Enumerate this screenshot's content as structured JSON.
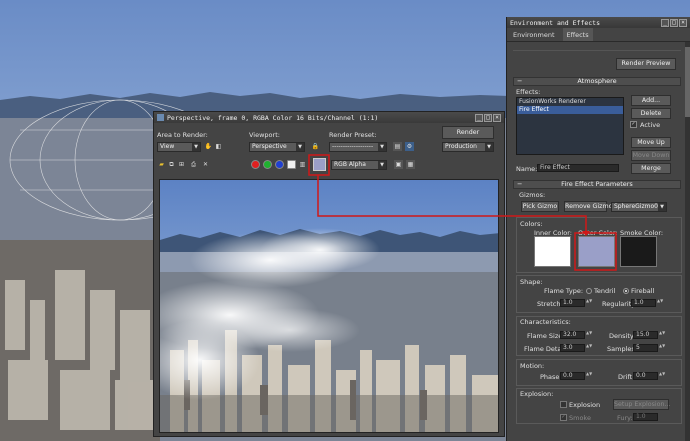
{
  "render_frame": {
    "title": "Perspective, frame 0, RGBA Color 16 Bits/Channel (1:1)",
    "area_label": "Area to Render:",
    "area_value": "View",
    "viewport_label": "Viewport:",
    "viewport_value": "Perspective",
    "preset_label": "Render Preset:",
    "preset_value": "-------------------",
    "render_button": "Render",
    "production_value": "Production",
    "channel_value": "RGB Alpha"
  },
  "env": {
    "title": "Environment and Effects",
    "tabs": [
      "Environment",
      "Effects"
    ],
    "render_preview": "Render Preview",
    "atmosphere_header": "Atmosphere",
    "effects_label": "Effects:",
    "effects_list": [
      "FusionWorks Renderer",
      "Fire Effect"
    ],
    "add": "Add...",
    "delete": "Delete",
    "active": "Active",
    "move_up": "Move Up",
    "move_down": "Move Down",
    "name_label": "Name:",
    "name_value": "Fire Effect",
    "merge": "Merge",
    "params_header": "Fire Effect Parameters",
    "gizmos_label": "Gizmos:",
    "pick_gizmo": "Pick Gizmo",
    "remove_gizmo": "Remove Gizmo",
    "gizmo_value": "SphereGizmo01",
    "colors_label": "Colors:",
    "inner_color": "Inner Color:",
    "outer_color": "Outer Color:",
    "smoke_color": "Smoke Color:",
    "colors": {
      "inner": "#ffffff",
      "outer": "#9a9fc8",
      "smoke": "#1a1a1a"
    },
    "shape_label": "Shape:",
    "flame_type": "Flame Type:",
    "tendril": "Tendril",
    "fireball": "Fireball",
    "stretch_label": "Stretch:",
    "stretch_value": "1.0",
    "regularity_label": "Regularity:",
    "regularity_value": "1.0",
    "char_label": "Characteristics:",
    "flame_size_label": "Flame Size:",
    "flame_size_value": "32.0",
    "density_label": "Density:",
    "density_value": "15.0",
    "flame_detail_label": "Flame Detail:",
    "flame_detail_value": "3.0",
    "samples_label": "Samples:",
    "samples_value": "5",
    "motion_label": "Motion:",
    "phase_label": "Phase:",
    "phase_value": "0.0",
    "drift_label": "Drift:",
    "drift_value": "0.0",
    "explosion_label": "Explosion:",
    "explosion": "Explosion",
    "setup_explosion": "Setup Explosion...",
    "smoke": "Smoke",
    "fury_label": "Fury:",
    "fury_value": "1.0"
  }
}
